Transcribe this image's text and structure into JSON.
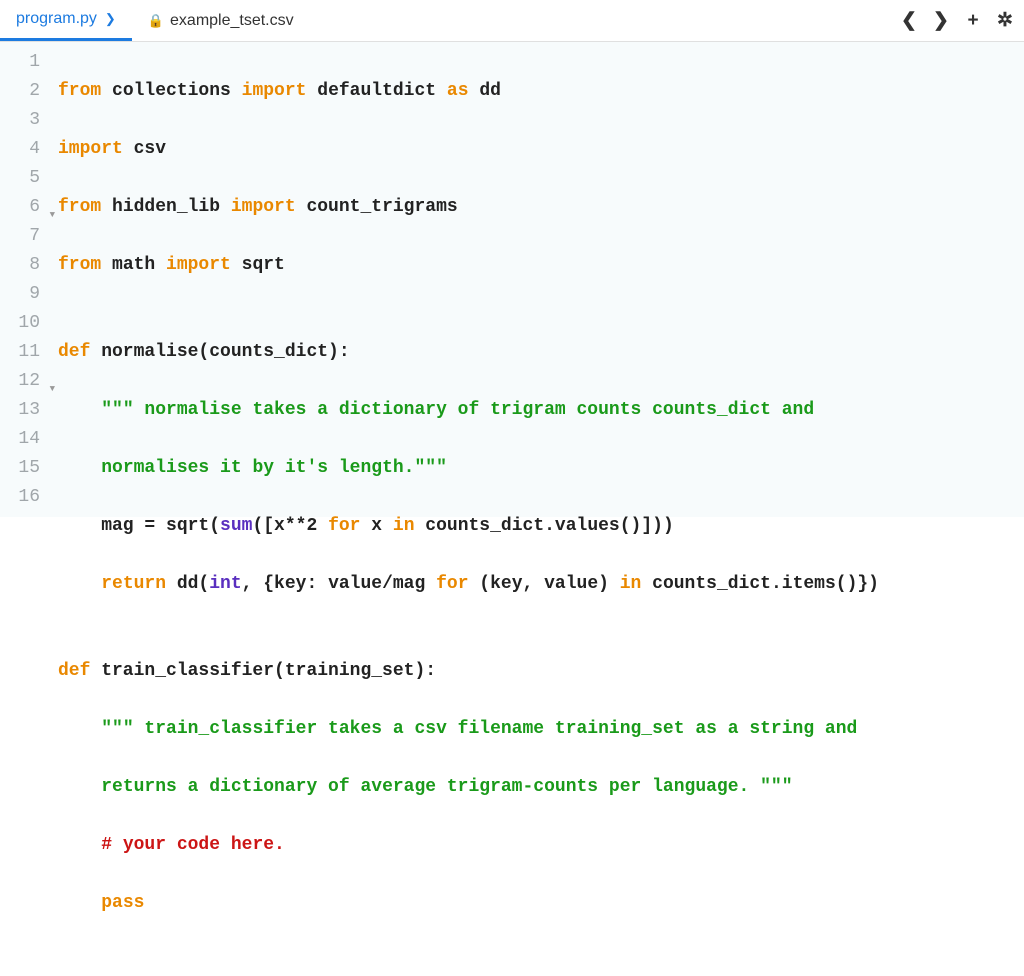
{
  "tabs": [
    {
      "label": "program.py",
      "active": true,
      "hasDropdown": true,
      "locked": false
    },
    {
      "label": "example_tset.csv",
      "active": false,
      "hasDropdown": false,
      "locked": true
    }
  ],
  "toolbar": {
    "prev": "❮",
    "next": "❯",
    "add": "+",
    "settings": "✲"
  },
  "lines": [
    {
      "n": "1",
      "fold": false
    },
    {
      "n": "2",
      "fold": false
    },
    {
      "n": "3",
      "fold": false
    },
    {
      "n": "4",
      "fold": false
    },
    {
      "n": "5",
      "fold": false
    },
    {
      "n": "6",
      "fold": true
    },
    {
      "n": "7",
      "fold": false
    },
    {
      "n": "8",
      "fold": false
    },
    {
      "n": "9",
      "fold": false
    },
    {
      "n": "10",
      "fold": false
    },
    {
      "n": "11",
      "fold": false
    },
    {
      "n": "12",
      "fold": true
    },
    {
      "n": "13",
      "fold": false
    },
    {
      "n": "14",
      "fold": false
    },
    {
      "n": "15",
      "fold": false
    },
    {
      "n": "16",
      "fold": false
    }
  ],
  "code": {
    "l1": {
      "a": "from",
      "b": " collections ",
      "c": "import",
      "d": " defaultdict ",
      "e": "as",
      "f": " dd"
    },
    "l2": {
      "a": "import",
      "b": " csv"
    },
    "l3": {
      "a": "from",
      "b": " hidden_lib ",
      "c": "import",
      "d": " count_trigrams"
    },
    "l4": {
      "a": "from",
      "b": " math ",
      "c": "import",
      "d": " sqrt"
    },
    "l5": {
      "a": ""
    },
    "l6": {
      "a": "def",
      "b": " normalise(counts_dict):"
    },
    "l7": {
      "a": "    ",
      "b": "\"\"\" normalise takes a dictionary of trigram counts counts_dict and"
    },
    "l8": {
      "a": "    ",
      "b": "normalises it by it's length.\"\"\""
    },
    "l9": {
      "a": "    mag = sqrt(",
      "b": "sum",
      "c": "([x**",
      "d": "2",
      "e": " ",
      "f": "for",
      "g": " x ",
      "h": "in",
      "i": " counts_dict.values()]))"
    },
    "l10": {
      "a": "    ",
      "b": "return",
      "c": " dd(",
      "d": "int",
      "e": ", {key: value/mag ",
      "f": "for",
      "g": " (key, value) ",
      "h": "in",
      "i": " counts_dict.items()})"
    },
    "l11": {
      "a": ""
    },
    "l12": {
      "a": "def",
      "b": " train_classifier(training_set):"
    },
    "l13": {
      "a": "    ",
      "b": "\"\"\" train_classifier takes a csv filename training_set as a string and"
    },
    "l14": {
      "a": "    ",
      "b": "returns a dictionary of average trigram-counts per language. \"\"\""
    },
    "l15": {
      "a": "    ",
      "b": "# your code here."
    },
    "l16": {
      "a": "    ",
      "b": "pass"
    }
  }
}
